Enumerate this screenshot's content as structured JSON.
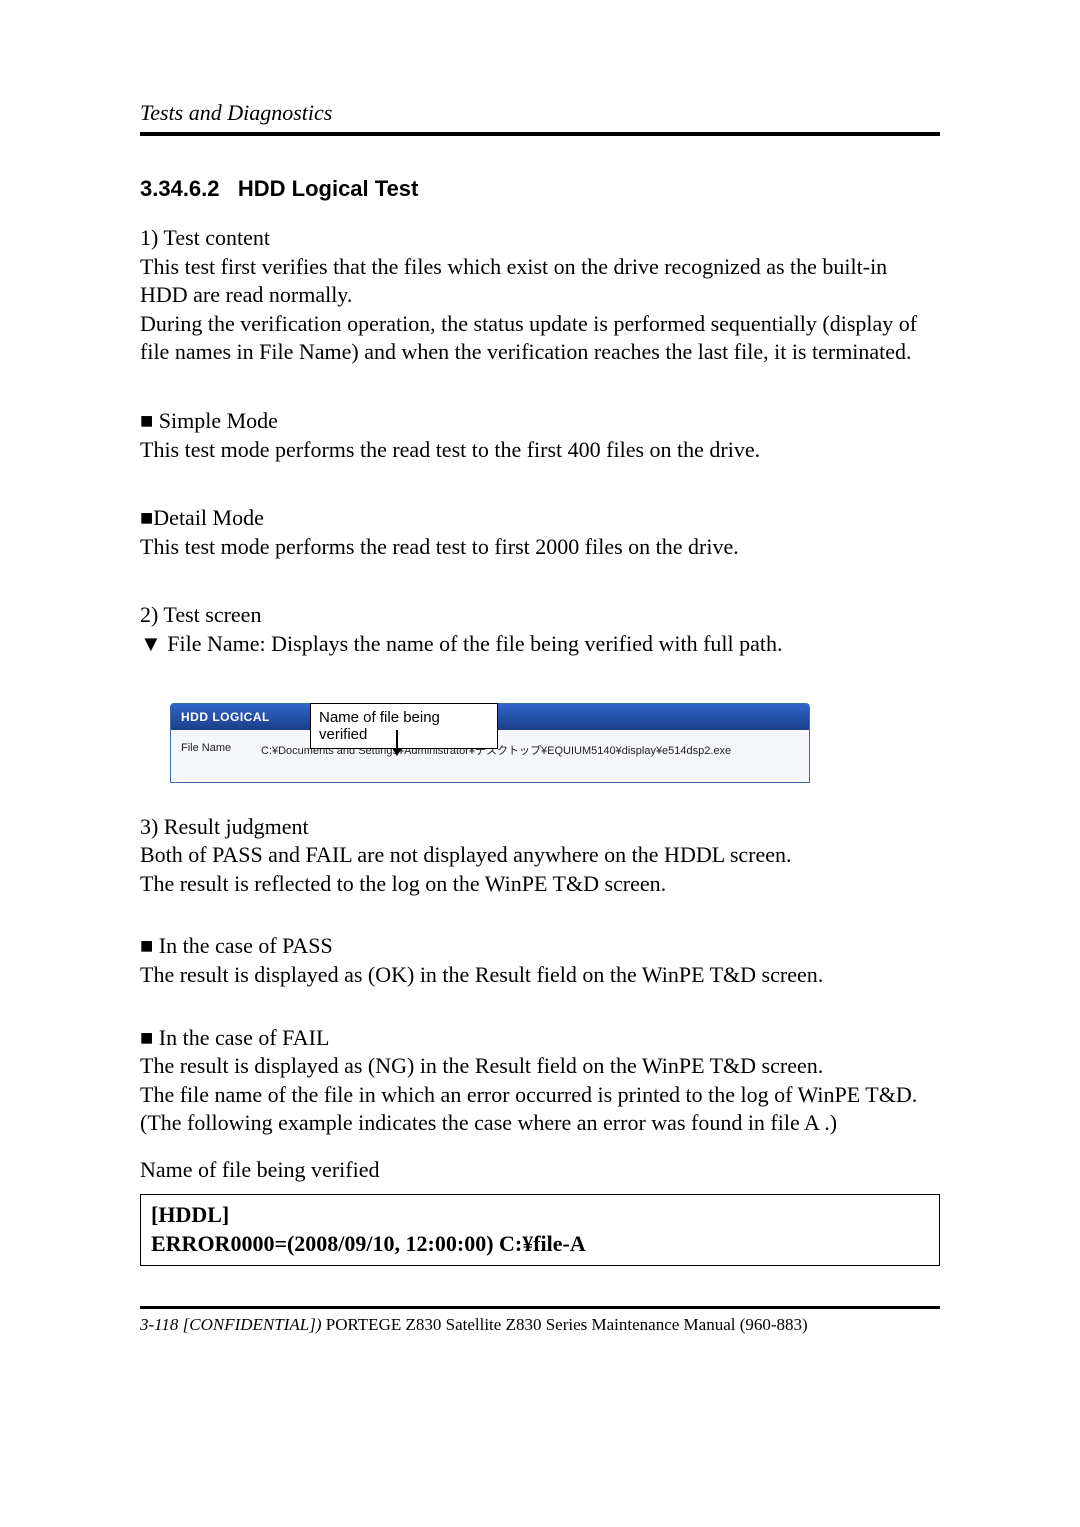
{
  "header": {
    "chapter": "Tests and Diagnostics"
  },
  "section": {
    "number": "3.34.6.2",
    "title": "HDD Logical Test"
  },
  "body": {
    "l1": "1) Test content",
    "l2": "This test first verifies that the files which exist on the drive recognized as the built-in HDD are read normally.",
    "l3": "During the verification operation, the status update is performed sequentially (display of file names in File Name) and when the verification reaches the last file, it is terminated.",
    "l4": "■ Simple Mode",
    "l5": "This test mode performs the read test to the first 400 files on the drive.",
    "l6": "■Detail Mode",
    "l7": "This test mode performs the read test to first 2000 files on the drive.",
    "l8": "2) Test screen",
    "l9": "▼  File Name: Displays the name of the file being verified with full path.",
    "l10": "3) Result judgment",
    "l11": "Both of PASS and FAIL are not displayed anywhere on the HDDL screen.",
    "l12": "The result is reflected to the log on the WinPE T&D screen.",
    "l13": "■ In the case of PASS",
    "l14": "The result is displayed as (OK) in the Result field on the WinPE T&D screen.",
    "l15": "■ In the case of FAIL",
    "l16": "The result is displayed as (NG) in the Result field on the WinPE T&D screen.",
    "l17": "The file name of the file in which an error occurred is printed to the log of WinPE T&D.",
    "l18": "(The following example indicates the case where an error was found in file A .)",
    "l19": "Name of file being verified"
  },
  "screenshot": {
    "callout": "Name of file being verified",
    "panel_title": "HDD LOGICAL",
    "file_label": "File Name",
    "file_value": "C:¥Documents and Settings¥Administrator¥デスクトップ¥EQUIUM5140¥display¥e514dsp2.exe"
  },
  "error_box": {
    "line1": "[HDDL]",
    "line2": "ERROR0000=(2008/09/10, 12:00:00) C:¥file-A"
  },
  "footer": {
    "left_italic": "3-118 [CONFIDENTIAL]) ",
    "right": "PORTEGE Z830 Satellite Z830 Series Maintenance Manual (960-883)"
  }
}
